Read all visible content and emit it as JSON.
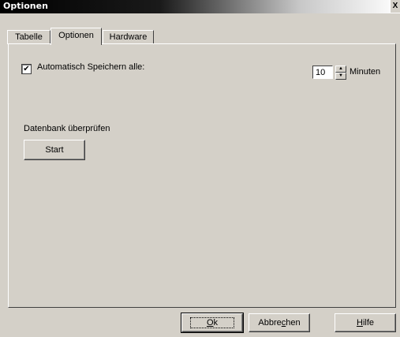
{
  "window": {
    "title": "Optionen",
    "close_label": "X"
  },
  "tabs": [
    {
      "label": "Tabelle"
    },
    {
      "label": "Optionen"
    },
    {
      "label": "Hardware"
    }
  ],
  "options": {
    "autosave_checked": true,
    "autosave_label": "Automatisch Speichern alle:",
    "interval_value": "10",
    "interval_unit": "Minuten",
    "db_check_label": "Datenbank überprüfen",
    "start_label": "Start"
  },
  "buttons": {
    "ok_mnemonic": "O",
    "ok_rest": "k",
    "cancel_pre": "Abbre",
    "cancel_mnemonic": "c",
    "cancel_post": "hen",
    "help_mnemonic": "H",
    "help_rest": "ilfe"
  }
}
